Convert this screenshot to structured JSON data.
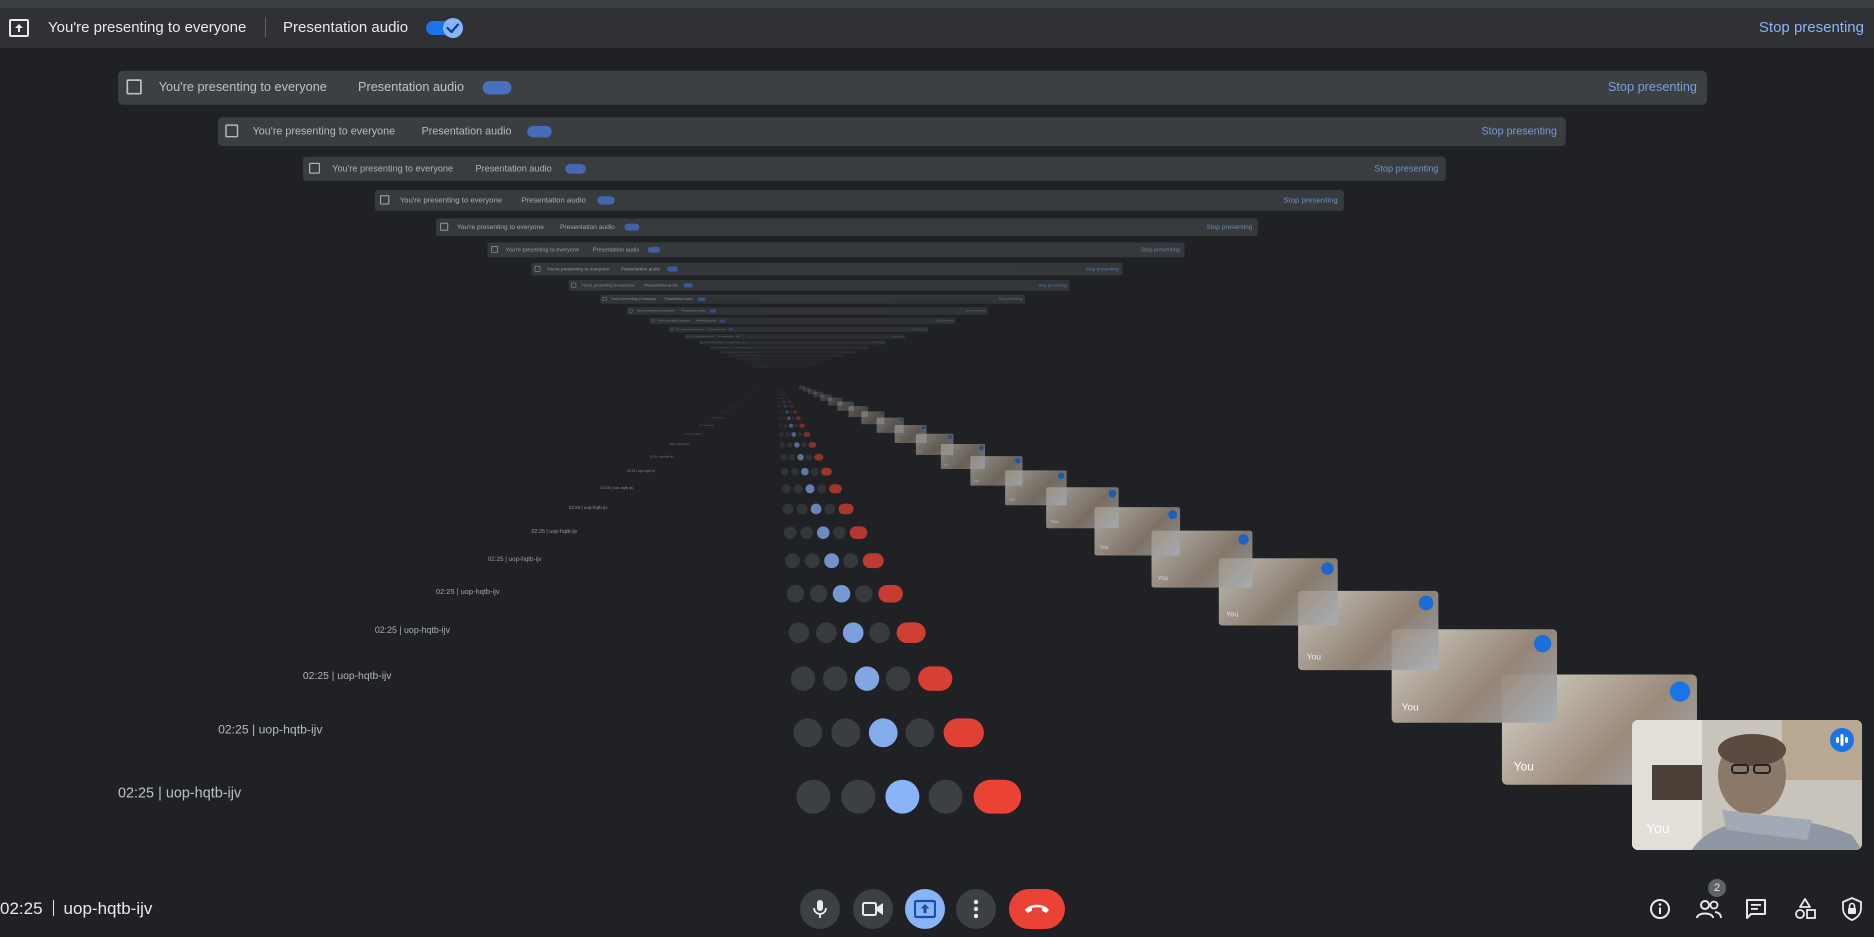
{
  "banner": {
    "message": "You're presenting to everyone",
    "audio_label": "Presentation audio",
    "audio_on": true,
    "stop_label": "Stop presenting"
  },
  "meeting": {
    "time": "02:25",
    "code": "uop-hqtb-ijv"
  },
  "controls": [
    {
      "name": "microphone-button",
      "icon": "mic-icon"
    },
    {
      "name": "camera-button",
      "icon": "videocam-icon"
    },
    {
      "name": "present-button",
      "icon": "present-to-all-icon"
    },
    {
      "name": "more-options-button",
      "icon": "more-vert-icon"
    },
    {
      "name": "leave-call-button",
      "icon": "call-end-icon"
    }
  ],
  "side_controls": [
    {
      "name": "meeting-details-button",
      "icon": "info-icon"
    },
    {
      "name": "people-button",
      "icon": "people-icon"
    },
    {
      "name": "chat-button",
      "icon": "chat-icon"
    },
    {
      "name": "activities-button",
      "icon": "shapes-icon"
    },
    {
      "name": "host-controls-button",
      "icon": "lock-person-icon"
    }
  ],
  "people_count": "2",
  "self_tile": {
    "name": "You",
    "speaking": true
  },
  "colors": {
    "background": "#202124",
    "accent": "#8ab4f8",
    "hangup": "#ea4335"
  }
}
